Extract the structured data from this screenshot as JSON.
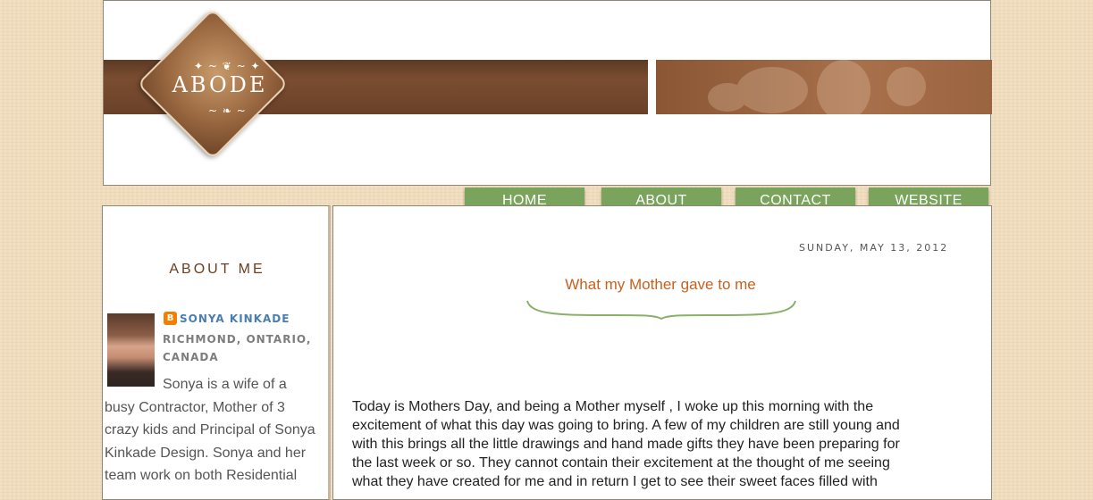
{
  "header": {
    "logo_text": "ABODE"
  },
  "nav": {
    "items": [
      {
        "label": "HOME"
      },
      {
        "label": "ABOUT"
      },
      {
        "label": "CONTACT"
      },
      {
        "label": "WEBSITE"
      }
    ]
  },
  "sidebar": {
    "title": "ABOUT ME",
    "author_name": "SONYA KINKADE",
    "location_line1": "RICHMOND, ONTARIO,",
    "location_line2": "CANADA",
    "bio_lines": [
      "Sonya is a wife of a",
      "busy Contractor, Mother of 3",
      "crazy kids and Principal of Sonya",
      "Kinkade Design. Sonya and her",
      "team work on both Residential"
    ]
  },
  "post": {
    "date": "SUNDAY, MAY 13, 2012",
    "title": "What my Mother gave to me",
    "body_lines": [
      "Today is Mothers Day, and being a Mother myself , I woke up this morning with the",
      "excitement of what this day was going to bring. A few of my children are still young and",
      "with this brings all the little drawings and hand made gifts they have been preparing for",
      "the last week or so. They cannot contain their excitement at the thought of me seeing",
      "what they have created for me and in return I get to see their sweet faces filled with"
    ]
  },
  "colors": {
    "nav_green": "#7aa35c",
    "brand_brown": "#6b3e1f",
    "title_orange": "#c8601f",
    "link_blue": "#4a7eb0"
  }
}
